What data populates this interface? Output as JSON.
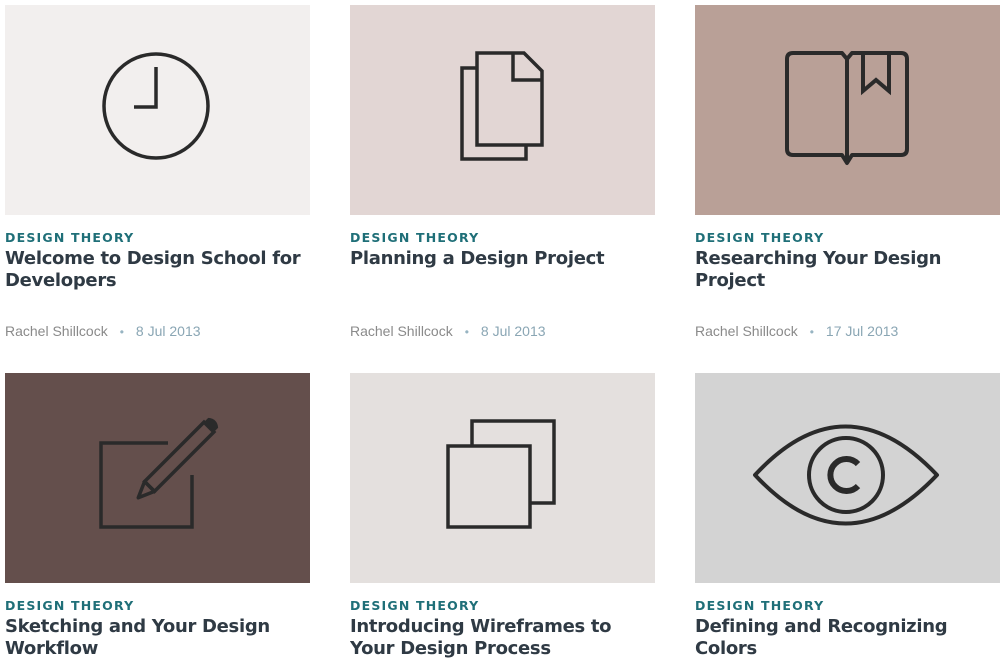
{
  "cards": [
    {
      "category": "DESIGN THEORY",
      "title": "Welcome to Design School for Developers",
      "author": "Rachel Shillcock",
      "date": "8 Jul 2013",
      "bg": "#f2efee",
      "icon": "clock-icon",
      "stroke": "#2a2a2a"
    },
    {
      "category": "DESIGN THEORY",
      "title": "Planning a Design Project",
      "author": "Rachel Shillcock",
      "date": "8 Jul 2013",
      "bg": "#e2d6d4",
      "icon": "documents-icon",
      "stroke": "#2a2a2a"
    },
    {
      "category": "DESIGN THEORY",
      "title": "Researching Your Design Project",
      "author": "Rachel Shillcock",
      "date": "17 Jul 2013",
      "bg": "#b9a097",
      "icon": "book-bookmark-icon",
      "stroke": "#2a2a2a"
    },
    {
      "category": "DESIGN THEORY",
      "title": "Sketching and Your Design Workflow",
      "author": "",
      "date": "",
      "bg": "#644f4c",
      "icon": "pencil-square-icon",
      "stroke": "#2a2a2a"
    },
    {
      "category": "DESIGN THEORY",
      "title": "Introducing Wireframes to Your Design Process",
      "author": "",
      "date": "",
      "bg": "#e4e0de",
      "icon": "overlapping-squares-icon",
      "stroke": "#2a2a2a"
    },
    {
      "category": "DESIGN THEORY",
      "title": "Defining and Recognizing Colors",
      "author": "",
      "date": "",
      "bg": "#d3d3d3",
      "icon": "eye-icon",
      "stroke": "#2a2a2a"
    }
  ],
  "meta_separator": "•"
}
